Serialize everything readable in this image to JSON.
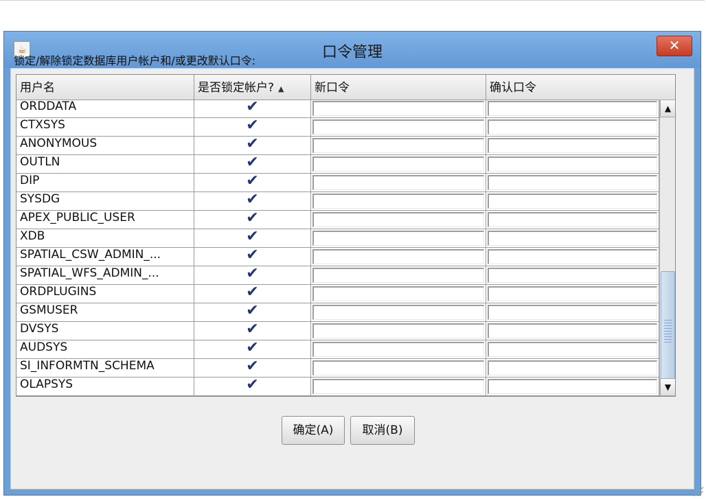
{
  "window": {
    "title": "口令管理",
    "close_symbol": "✕",
    "app_icon": "java-icon"
  },
  "instruction": "锁定/解除锁定数据库用户帐户和/或更改默认口令:",
  "table": {
    "columns": [
      "用户名",
      "是否锁定帐户?",
      "新口令",
      "确认口令"
    ],
    "sort_indicator": "▲",
    "rows": [
      {
        "username": "ORDDATA",
        "locked": true
      },
      {
        "username": "CTXSYS",
        "locked": true
      },
      {
        "username": "ANONYMOUS",
        "locked": true
      },
      {
        "username": "OUTLN",
        "locked": true
      },
      {
        "username": "DIP",
        "locked": true
      },
      {
        "username": "SYSDG",
        "locked": true
      },
      {
        "username": "APEX_PUBLIC_USER",
        "locked": true
      },
      {
        "username": "XDB",
        "locked": true
      },
      {
        "username": "SPATIAL_CSW_ADMIN_...",
        "locked": true
      },
      {
        "username": "SPATIAL_WFS_ADMIN_...",
        "locked": true
      },
      {
        "username": "ORDPLUGINS",
        "locked": true
      },
      {
        "username": "GSMUSER",
        "locked": true
      },
      {
        "username": "DVSYS",
        "locked": true
      },
      {
        "username": "AUDSYS",
        "locked": true
      },
      {
        "username": "SI_INFORMTN_SCHEMA",
        "locked": true
      },
      {
        "username": "OLAPSYS",
        "locked": true
      }
    ],
    "check_symbol": "✔"
  },
  "scrollbar": {
    "up": "▲",
    "down": "▼"
  },
  "buttons": {
    "ok": "确定(A)",
    "cancel": "取消(B)"
  },
  "colors": {
    "titlebar": "#6a9fd8",
    "close": "#c63c25",
    "check": "#25337a"
  }
}
